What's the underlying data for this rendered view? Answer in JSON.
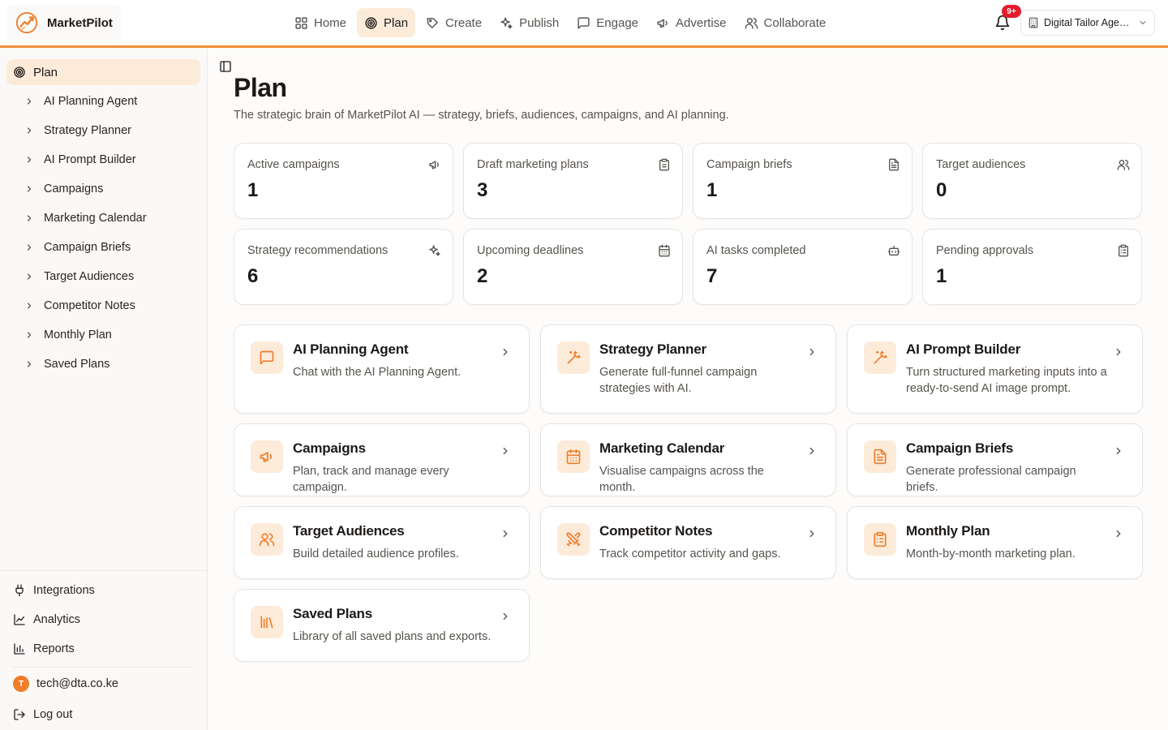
{
  "app": {
    "name": "MarketPilot"
  },
  "nav": {
    "items": [
      {
        "label": "Home"
      },
      {
        "label": "Plan"
      },
      {
        "label": "Create"
      },
      {
        "label": "Publish"
      },
      {
        "label": "Engage"
      },
      {
        "label": "Advertise"
      },
      {
        "label": "Collaborate"
      }
    ],
    "active": "Plan"
  },
  "notifications": {
    "badge": "9+"
  },
  "org": {
    "name": "Digital Tailor Agen..."
  },
  "sidebar": {
    "section": "Plan",
    "items": [
      {
        "label": "AI Planning Agent"
      },
      {
        "label": "Strategy Planner"
      },
      {
        "label": "AI Prompt Builder"
      },
      {
        "label": "Campaigns"
      },
      {
        "label": "Marketing Calendar"
      },
      {
        "label": "Campaign Briefs"
      },
      {
        "label": "Target Audiences"
      },
      {
        "label": "Competitor Notes"
      },
      {
        "label": "Monthly Plan"
      },
      {
        "label": "Saved Plans"
      }
    ],
    "bottom": [
      {
        "label": "Integrations"
      },
      {
        "label": "Analytics"
      },
      {
        "label": "Reports"
      }
    ],
    "user": {
      "initial": "T",
      "email": "tech@dta.co.ke"
    },
    "logout": "Log out"
  },
  "page": {
    "title": "Plan",
    "subtitle": "The strategic brain of MarketPilot AI — strategy, briefs, audiences, campaigns, and AI planning."
  },
  "stats": [
    {
      "label": "Active campaigns",
      "value": "1",
      "icon": "megaphone-icon"
    },
    {
      "label": "Draft marketing plans",
      "value": "3",
      "icon": "clipboard-icon"
    },
    {
      "label": "Campaign briefs",
      "value": "1",
      "icon": "file-text-icon"
    },
    {
      "label": "Target audiences",
      "value": "0",
      "icon": "users-icon"
    },
    {
      "label": "Strategy recommendations",
      "value": "6",
      "icon": "sparkles-icon"
    },
    {
      "label": "Upcoming deadlines",
      "value": "2",
      "icon": "calendar-icon"
    },
    {
      "label": "AI tasks completed",
      "value": "7",
      "icon": "bot-icon"
    },
    {
      "label": "Pending approvals",
      "value": "1",
      "icon": "clipboard-list-icon"
    }
  ],
  "cards": [
    {
      "title": "AI Planning Agent",
      "desc": "Chat with the AI Planning Agent.",
      "icon": "message-icon"
    },
    {
      "title": "Strategy Planner",
      "desc": "Generate full-funnel campaign strategies with AI.",
      "icon": "magic-wand-icon"
    },
    {
      "title": "AI Prompt Builder",
      "desc": "Turn structured marketing inputs into a ready-to-send AI image prompt.",
      "icon": "magic-wand-icon"
    },
    {
      "title": "Campaigns",
      "desc": "Plan, track and manage every campaign.",
      "icon": "megaphone-icon"
    },
    {
      "title": "Marketing Calendar",
      "desc": "Visualise campaigns across the month.",
      "icon": "calendar-icon"
    },
    {
      "title": "Campaign Briefs",
      "desc": "Generate professional campaign briefs.",
      "icon": "file-text-icon"
    },
    {
      "title": "Target Audiences",
      "desc": "Build detailed audience profiles.",
      "icon": "users-icon"
    },
    {
      "title": "Competitor Notes",
      "desc": "Track competitor activity and gaps.",
      "icon": "swords-icon"
    },
    {
      "title": "Monthly Plan",
      "desc": "Month-by-month marketing plan.",
      "icon": "clipboard-list-icon"
    },
    {
      "title": "Saved Plans",
      "desc": "Library of all saved plans and exports.",
      "icon": "library-icon"
    }
  ],
  "colors": {
    "accent": "#ef7d2a",
    "accent_soft": "#fdebd9",
    "accent_bar": "#f0913a",
    "badge": "#e11d2e"
  }
}
